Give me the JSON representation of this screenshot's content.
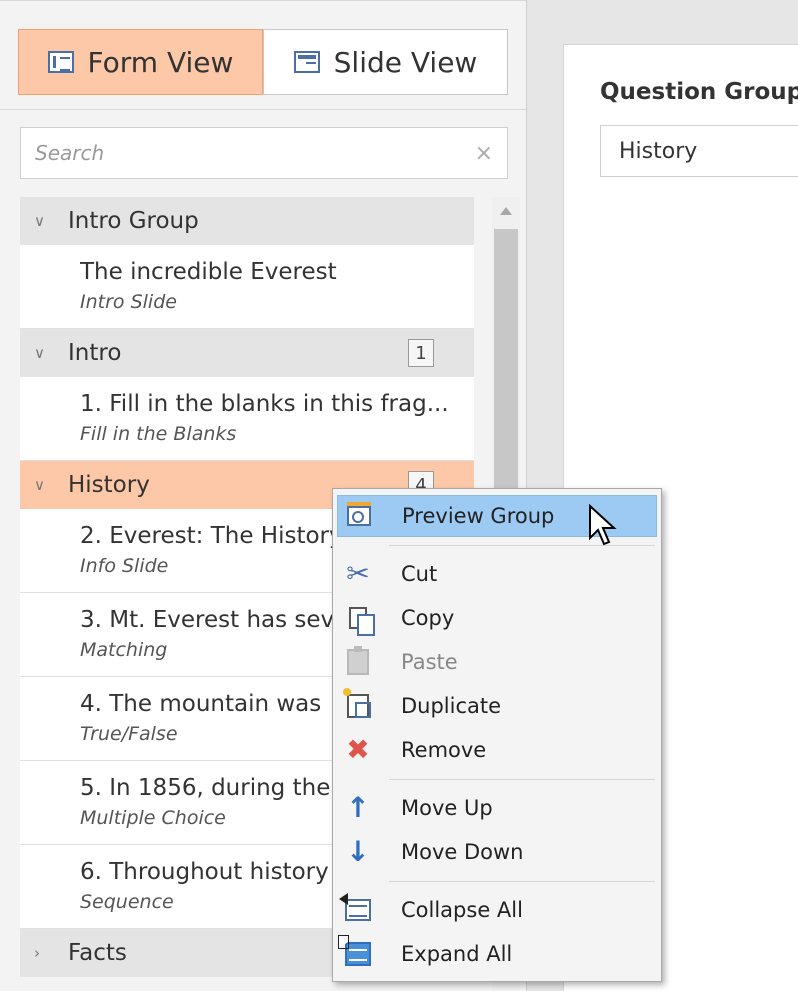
{
  "view_toggle": {
    "form_view_label": "Form View",
    "slide_view_label": "Slide View"
  },
  "search": {
    "placeholder": "Search",
    "clear_glyph": "×"
  },
  "tree": {
    "groups": [
      {
        "name": "Intro Group",
        "expanded": true,
        "items": [
          {
            "title": "The incredible Everest",
            "type": "Intro Slide"
          }
        ]
      },
      {
        "name": "Intro",
        "count": "1",
        "expanded": true,
        "items": [
          {
            "title": "1. Fill in the blanks in this frag...",
            "type": "Fill in the Blanks"
          }
        ]
      },
      {
        "name": "History",
        "count": "4",
        "expanded": true,
        "selected": true,
        "items": [
          {
            "title": "2. Everest: The History",
            "type": "Info Slide"
          },
          {
            "title": "3. Mt. Everest has several",
            "type": "Matching"
          },
          {
            "title": "4. The mountain was",
            "type": "True/False"
          },
          {
            "title": "5. In 1856, during the",
            "type": "Multiple Choice"
          },
          {
            "title": "6. Throughout history",
            "type": "Sequence"
          }
        ]
      },
      {
        "name": "Facts",
        "expanded": false,
        "items": []
      }
    ]
  },
  "right_panel": {
    "label": "Question Group",
    "value": "History"
  },
  "context_menu": {
    "items": [
      {
        "label": "Preview Group",
        "icon": "preview-group-icon",
        "hover": true
      },
      {
        "label": "Cut",
        "icon": "cut-icon"
      },
      {
        "label": "Copy",
        "icon": "copy-icon"
      },
      {
        "label": "Paste",
        "icon": "paste-icon",
        "disabled": true
      },
      {
        "label": "Duplicate",
        "icon": "duplicate-icon"
      },
      {
        "label": "Remove",
        "icon": "remove-icon"
      },
      {
        "label": "Move Up",
        "icon": "move-up-icon"
      },
      {
        "label": "Move Down",
        "icon": "move-down-icon"
      },
      {
        "label": "Collapse All",
        "icon": "collapse-all-icon"
      },
      {
        "label": "Expand All",
        "icon": "expand-all-icon"
      }
    ]
  },
  "colors": {
    "selected_row": "#fdc8a7",
    "menu_hover": "#9dcaf2",
    "icon_blue": "#4a6fa5",
    "remove_red": "#e0544a"
  }
}
